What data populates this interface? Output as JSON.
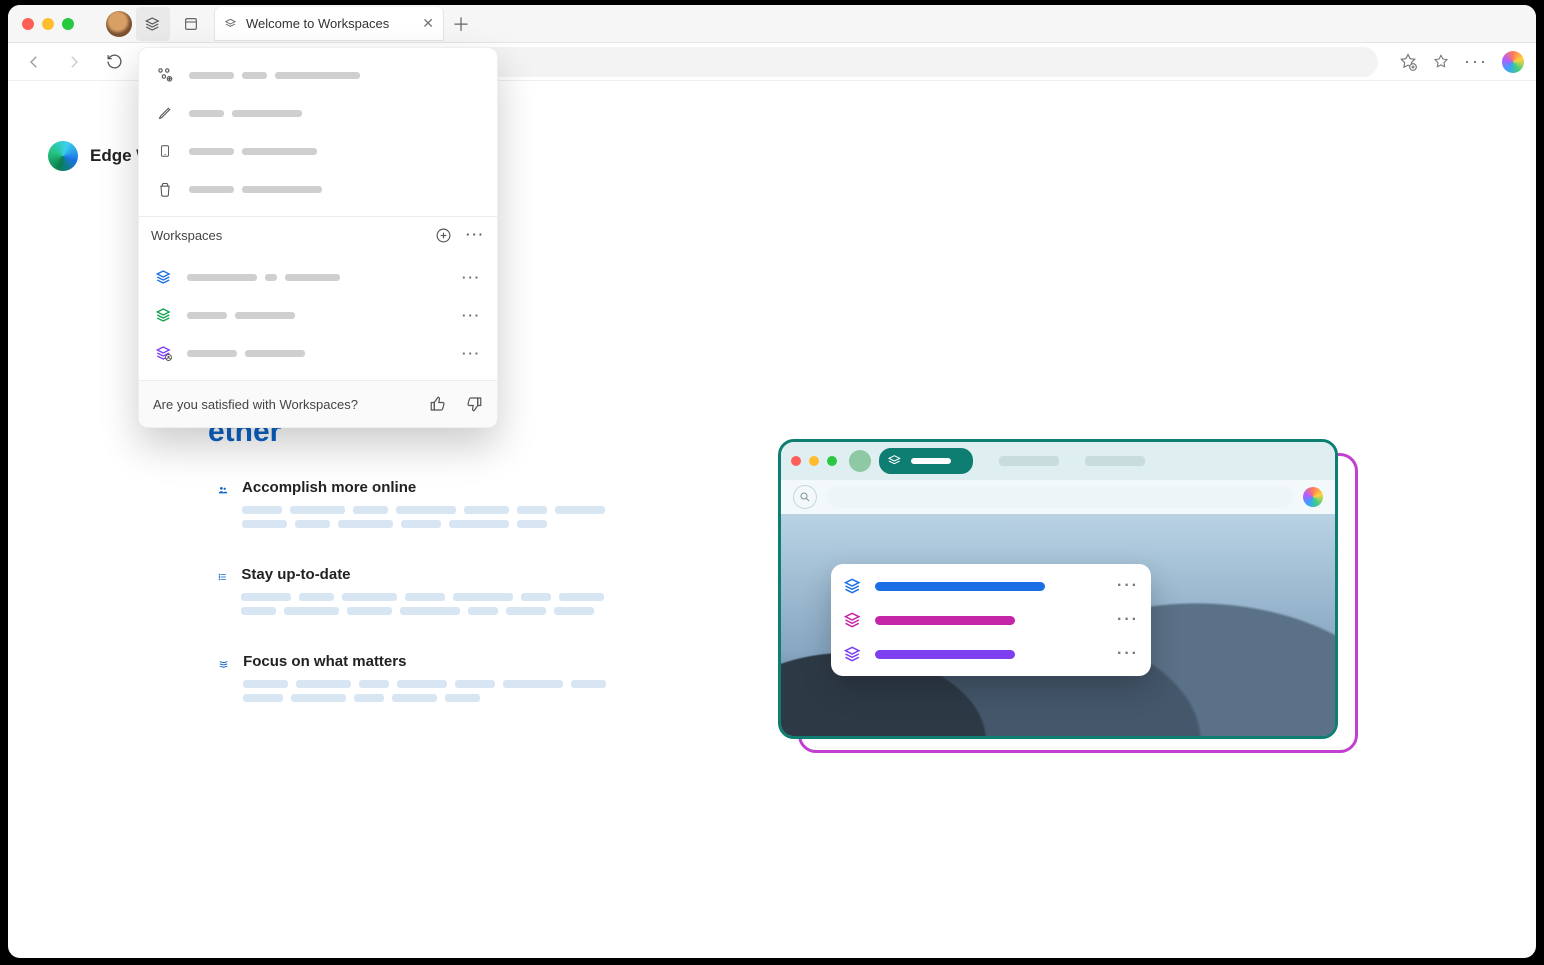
{
  "window": {
    "tab_title": "Welcome to Workspaces"
  },
  "page": {
    "brand_label": "Edge W",
    "hero_fragment": "ether",
    "features": [
      {
        "title": "Accomplish more online"
      },
      {
        "title": "Stay up-to-date"
      },
      {
        "title": "Focus on what matters"
      }
    ]
  },
  "popup": {
    "section_heading": "Workspaces",
    "feedback_prompt": "Are you satisfied with Workspaces?",
    "workspace_items": [
      {
        "color": "#1b6fe4"
      },
      {
        "color": "#12a150"
      },
      {
        "color": "#7d3ff0"
      }
    ]
  }
}
